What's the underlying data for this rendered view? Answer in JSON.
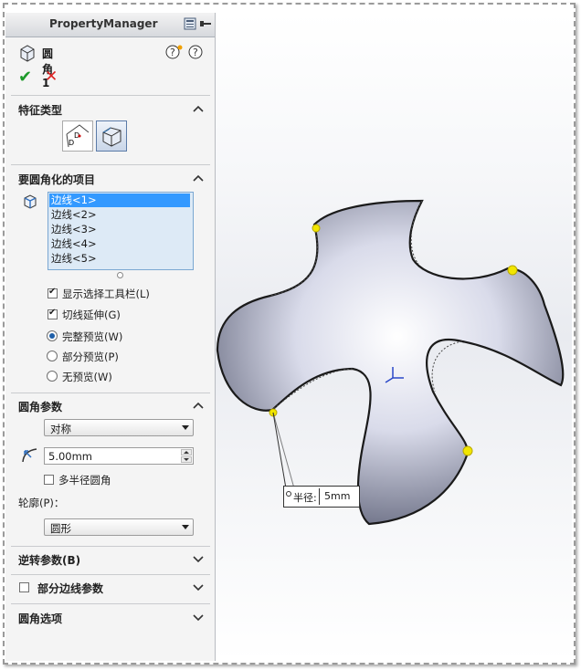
{
  "panel": {
    "title": "PropertyManager",
    "feature_name": "圆角1",
    "ok_icon": "checkmark-icon",
    "cancel_icon": "x-icon"
  },
  "sections": {
    "feature_type": {
      "title": "特征类型"
    },
    "items_to_fillet": {
      "title": "要圆角化的项目",
      "edges": [
        "边线<1>",
        "边线<2>",
        "边线<3>",
        "边线<4>",
        "边线<5>"
      ],
      "selected_index": 0,
      "options": {
        "show_toolbar": {
          "label": "显示选择工具栏(L)",
          "checked": true
        },
        "tangent_propagation": {
          "label": "切线延伸(G)",
          "checked": true
        },
        "full_preview": {
          "label": "完整预览(W)",
          "selected": true
        },
        "partial_preview": {
          "label": "部分预览(P)",
          "selected": false
        },
        "no_preview": {
          "label": "无预览(W)",
          "selected": false
        }
      }
    },
    "fillet_params": {
      "title": "圆角参数",
      "method": "对称",
      "radius": "5.00mm",
      "multi_radius": {
        "label": "多半径圆角",
        "checked": false
      },
      "profile_label": "轮廓(P)：",
      "profile": "圆形"
    },
    "setback": {
      "title": "逆转参数(B)"
    },
    "partial_edge": {
      "title": "部分边线参数",
      "checked": false
    },
    "fillet_options": {
      "title": "圆角选项"
    }
  },
  "viewport": {
    "callout_label": "半径:",
    "callout_value": "5mm"
  },
  "colors": {
    "selection": "#3399ff",
    "edge_highlight": "#f2e600",
    "part_fill": "#b9bed3"
  }
}
